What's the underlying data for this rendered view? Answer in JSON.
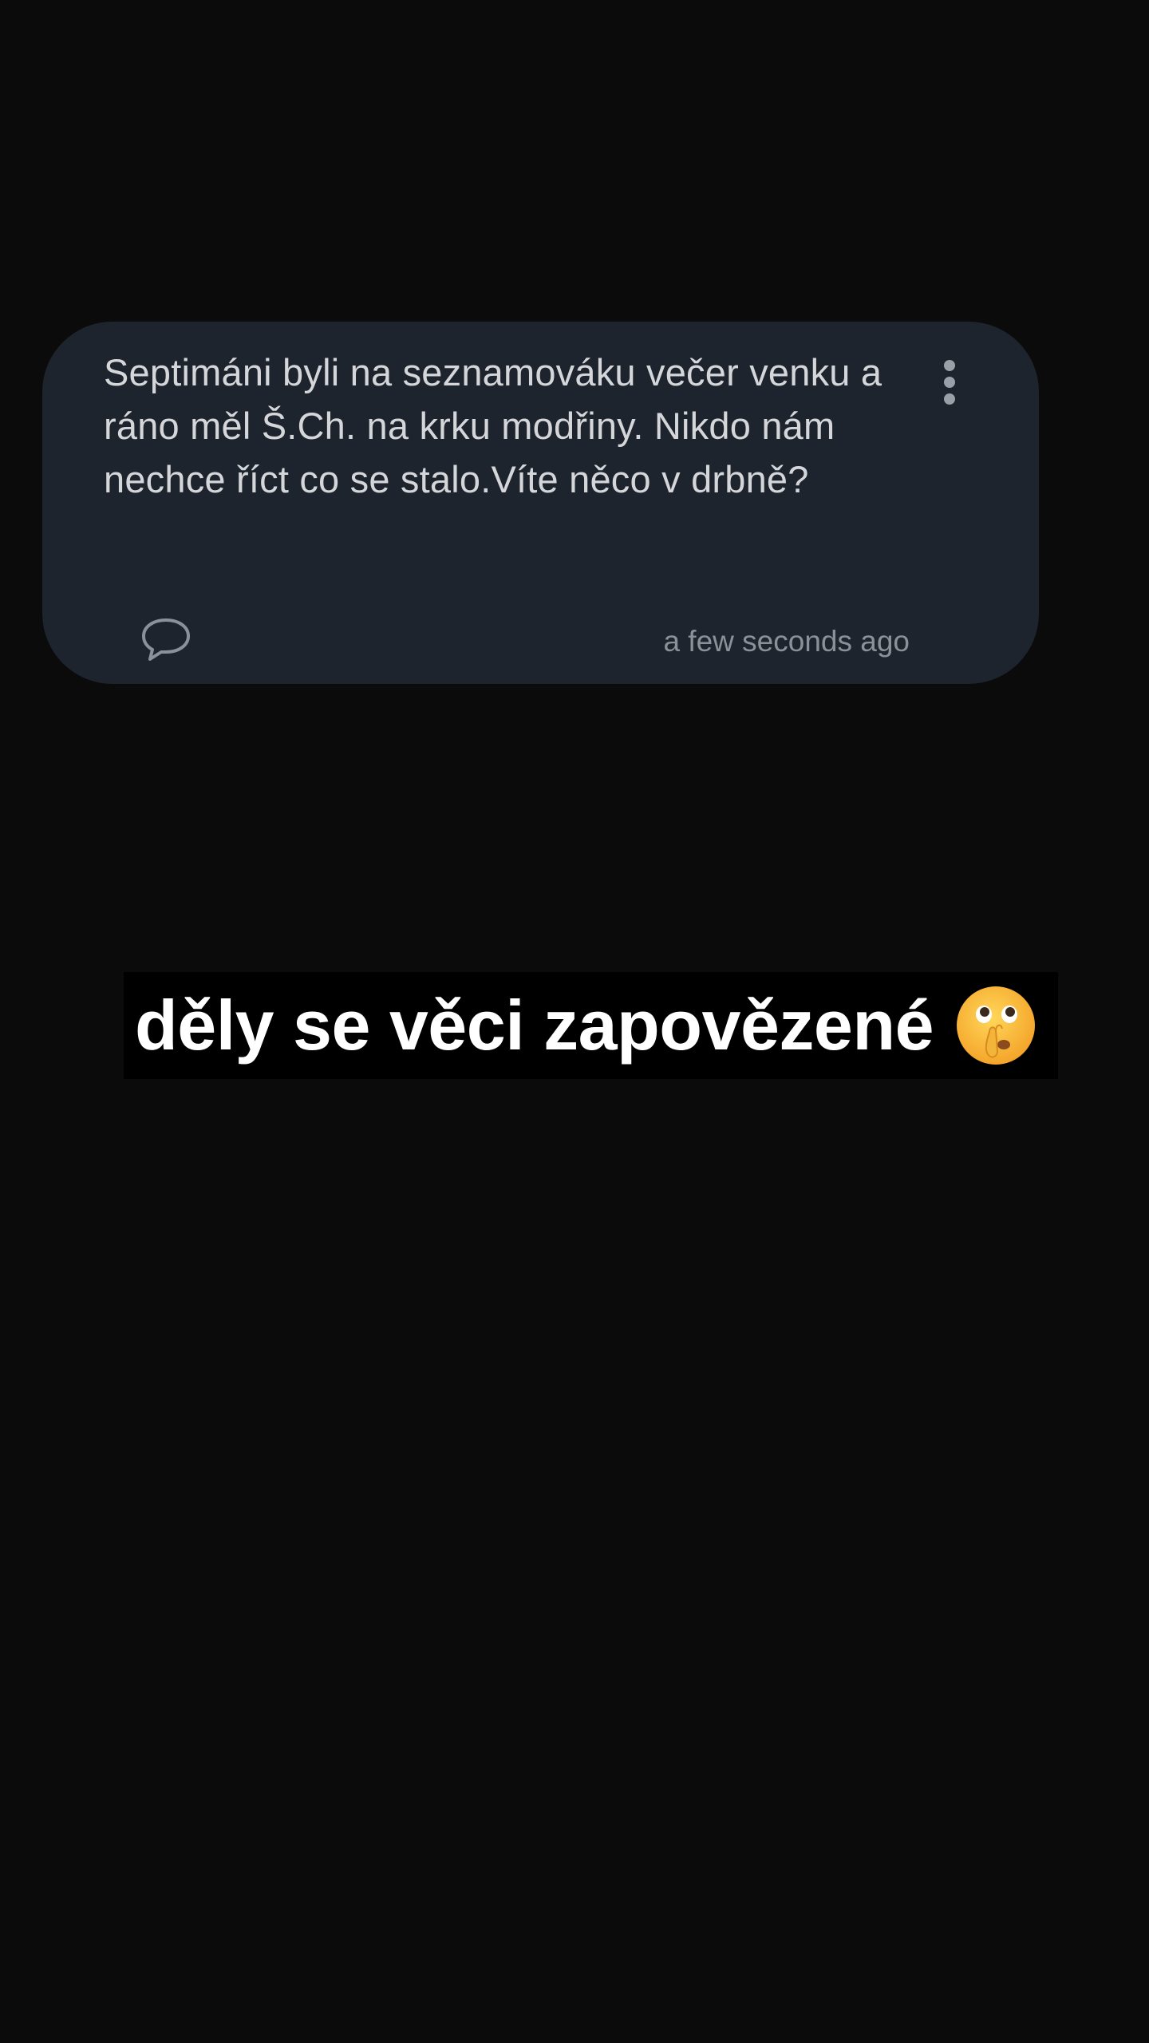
{
  "post": {
    "text": "Septimáni byli na seznamováku večer venku a ráno měl Š.Ch. na krku modřiny. Nikdo nám nechce říct co se stalo.Víte něco v drbně?",
    "timestamp": "a few seconds ago",
    "menu_icon": "more-vertical-icon",
    "comment_icon": "comment-bubble-icon"
  },
  "caption": {
    "text": "děly se věci zapovězené",
    "emoji_icon": "shushing-face-icon"
  },
  "colors": {
    "background": "#0b0b0c",
    "card": "#1e242d",
    "post_text": "#d4d6da",
    "muted": "#8c9199",
    "caption_text": "#ffffff",
    "caption_bg": "#000000"
  }
}
